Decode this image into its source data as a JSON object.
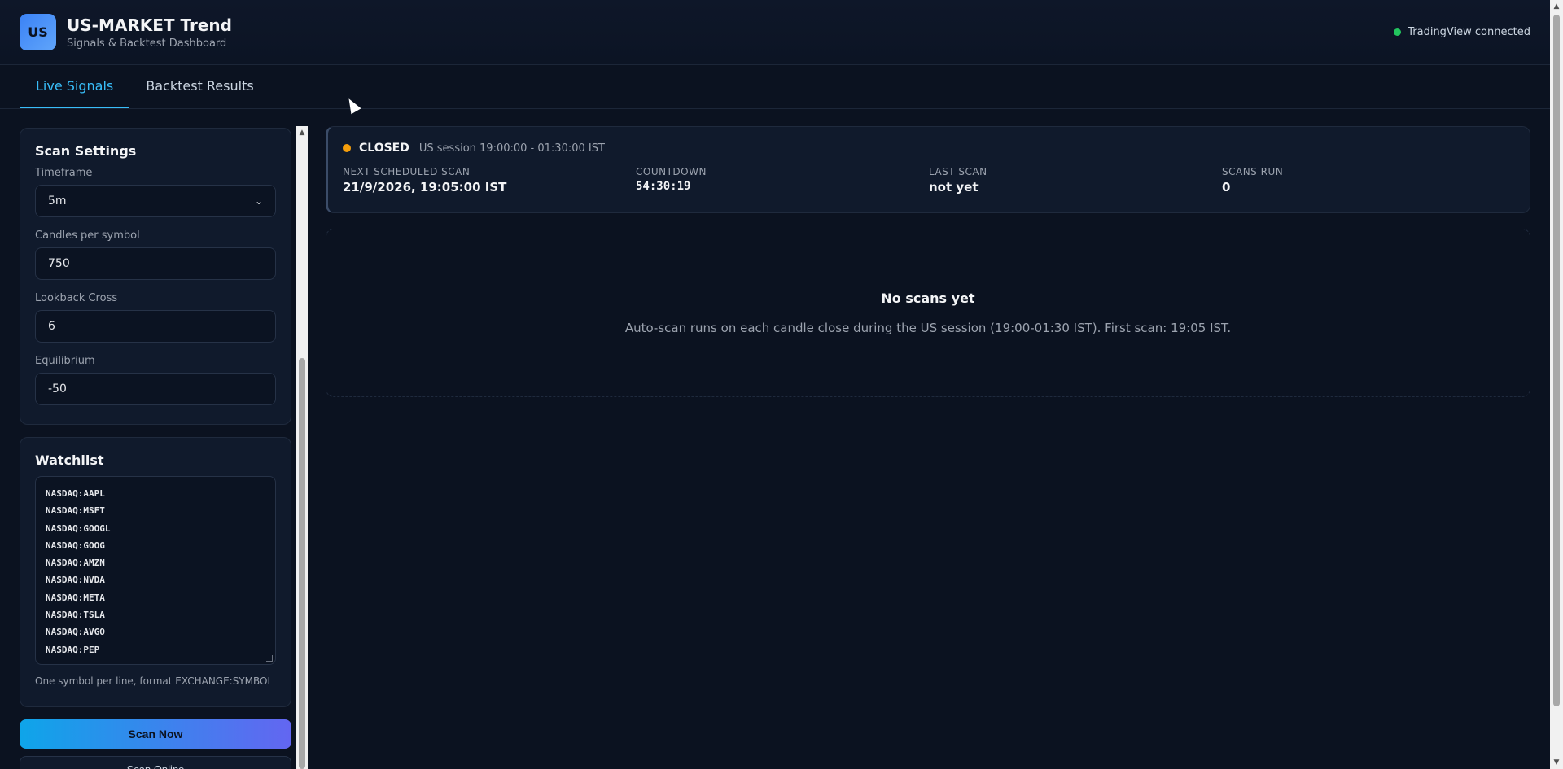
{
  "header": {
    "logo_text": "US",
    "title": "US-MARKET Trend",
    "subtitle": "Signals & Backtest Dashboard",
    "connection_status": "TradingView connected",
    "connection_color": "#22c55e"
  },
  "tabs": [
    {
      "label": "Live Signals",
      "active": true
    },
    {
      "label": "Backtest Results",
      "active": false
    }
  ],
  "scan_settings": {
    "title": "Scan Settings",
    "timeframe_label": "Timeframe",
    "timeframe_value": "5m",
    "candles_label": "Candles per symbol",
    "candles_value": "750",
    "lookback_label": "Lookback Cross",
    "lookback_value": "6",
    "equilibrium_label": "Equilibrium",
    "equilibrium_value": "-50"
  },
  "watchlist": {
    "title": "Watchlist",
    "symbols": [
      "NASDAQ:AAPL",
      "NASDAQ:MSFT",
      "NASDAQ:GOOGL",
      "NASDAQ:GOOG",
      "NASDAQ:AMZN",
      "NASDAQ:NVDA",
      "NASDAQ:META",
      "NASDAQ:TSLA",
      "NASDAQ:AVGO",
      "NASDAQ:PEP"
    ],
    "hint": "One symbol per line, format EXCHANGE:SYMBOL"
  },
  "actions": {
    "scan_now": "Scan Now",
    "secondary_partial": "Scan Online"
  },
  "status": {
    "state": "CLOSED",
    "state_color": "#f59e0b",
    "session": "US session 19:00:00 - 01:30:00 IST",
    "next_scan_label": "NEXT SCHEDULED SCAN",
    "next_scan_value": "21/9/2026, 19:05:00 IST",
    "countdown_label": "COUNTDOWN",
    "countdown_value": "54:30:19",
    "last_scan_label": "LAST SCAN",
    "last_scan_value": "not yet",
    "scans_run_label": "SCANS RUN",
    "scans_run_value": "0"
  },
  "empty_state": {
    "title": "No scans yet",
    "message": "Auto-scan runs on each candle close during the US session (19:00-01:30 IST). First scan: 19:05 IST."
  }
}
